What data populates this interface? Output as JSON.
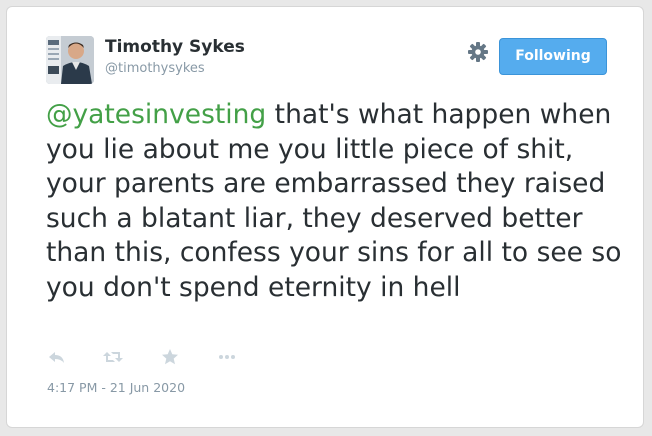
{
  "user": {
    "display_name": "Timothy Sykes",
    "handle": "@timothysykes"
  },
  "follow_button": {
    "label": "Following"
  },
  "tweet": {
    "mention": "@yatesinvesting",
    "body": " that's what happen when you lie about me you little piece of shit, your parents are embarrassed they raised such a blatant liar, they deserved better than this, confess your sins for all to see so you don't spend eternity in hell",
    "timestamp": "4:17 PM - 21 Jun 2020"
  },
  "icons": {
    "settings": "gear-icon",
    "reply": "reply-icon",
    "retweet": "retweet-icon",
    "favorite": "star-icon",
    "more": "more-icon"
  },
  "colors": {
    "accent": "#55acee",
    "mention": "#43a047",
    "text": "#292f33",
    "muted": "#8899a6"
  }
}
